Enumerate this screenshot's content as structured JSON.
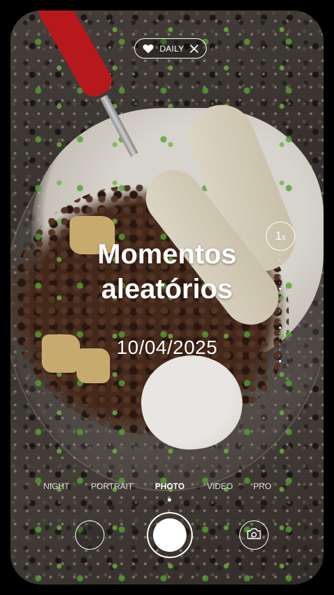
{
  "badge": {
    "label": "DAILY"
  },
  "zoom": {
    "value": "1",
    "unit": "x"
  },
  "title": {
    "line1": "Momentos",
    "line2": "aleatórios"
  },
  "date": "10/04/2025",
  "modes": [
    {
      "label": "NIGHT",
      "active": false
    },
    {
      "label": "PORTRAIT",
      "active": false
    },
    {
      "label": "PHOTO",
      "active": true
    },
    {
      "label": "VIDEO",
      "active": false
    },
    {
      "label": "PRO",
      "active": false
    }
  ],
  "icons": {
    "badge": "heart-icon",
    "badge_close": "close-icon",
    "switch_camera": "camera-switch-icon"
  },
  "colors": {
    "accent": "#ffffff",
    "fork_handle": "#c61b1e"
  }
}
